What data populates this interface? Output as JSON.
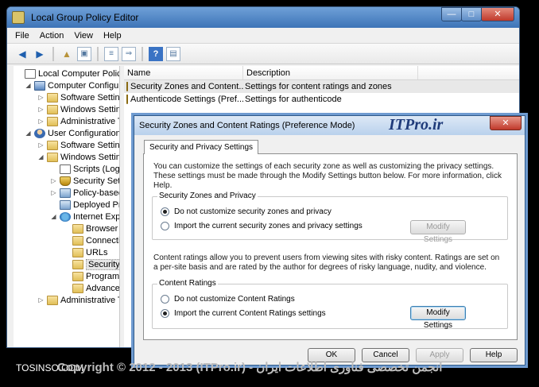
{
  "window": {
    "title": "Local Group Policy Editor",
    "buttons": [
      "—",
      "□",
      "✕"
    ]
  },
  "menu": [
    "File",
    "Action",
    "View",
    "Help"
  ],
  "toolbar": {
    "icons": [
      "back-icon",
      "forward-icon",
      "up-folder-icon",
      "show-hide-tree-icon",
      "export-list-icon",
      "properties-icon",
      "help-icon",
      "filter-icon"
    ],
    "help_glyph": "?"
  },
  "tree": [
    {
      "label": "Local Computer Policy",
      "icon": "policy"
    },
    {
      "label": "Computer Configura",
      "icon": "computer"
    },
    {
      "label": "Software Settings",
      "icon": "folder"
    },
    {
      "label": "Windows Setting",
      "icon": "folder"
    },
    {
      "label": "Administrative T",
      "icon": "folder"
    },
    {
      "label": "User Configuration",
      "icon": "user"
    },
    {
      "label": "Software Settings",
      "icon": "folder"
    },
    {
      "label": "Windows Setting",
      "icon": "folder"
    },
    {
      "label": "Scripts (Logo",
      "icon": "policy"
    },
    {
      "label": "Security Setti",
      "icon": "shield"
    },
    {
      "label": "Policy-based",
      "icon": "chart"
    },
    {
      "label": "Deployed Prin",
      "icon": "printer"
    },
    {
      "label": "Internet Explo",
      "icon": "ie"
    },
    {
      "label": "Browser U",
      "icon": "folder"
    },
    {
      "label": "Connectio",
      "icon": "folder"
    },
    {
      "label": "URLs",
      "icon": "folder"
    },
    {
      "label": "Security",
      "icon": "folder"
    },
    {
      "label": "Programs",
      "icon": "folder"
    },
    {
      "label": "Advanced",
      "icon": "folder"
    },
    {
      "label": "Administrative Te",
      "icon": "folder"
    }
  ],
  "list": {
    "headers": [
      "Name",
      "Description"
    ],
    "rows": [
      {
        "name": "Security Zones and Content...",
        "desc": "Settings for content ratings and zones"
      },
      {
        "name": "Authenticode Settings (Pref...",
        "desc": "Settings for authenticode"
      }
    ]
  },
  "dialog": {
    "title": "Security Zones and Content Ratings (Preference Mode)",
    "logo": "ITPro.ir",
    "close": "✕",
    "tab": "Security and Privacy Settings",
    "intro": "You can customize the settings of each security zone as well as customizing the privacy settings. These settings must be made through the Modify Settings button below. For more information, click Help.",
    "zones_group": "Security Zones and Privacy",
    "zones_opt1": "Do not customize security zones and privacy",
    "zones_opt2": "Import the current security zones and privacy settings",
    "modify_label": "Modify Settings",
    "ratings_text": "Content ratings allow you to prevent users from viewing sites with risky content. Ratings are set on a per-site basis and are rated by the author for degrees of risky language, nudity, and violence.",
    "ratings_group": "Content Ratings",
    "ratings_opt1": "Do not customize Content Ratings",
    "ratings_opt2": "Import the current Content Ratings settings",
    "ok": "OK",
    "cancel": "Cancel",
    "apply": "Apply",
    "help": "Help"
  },
  "footer": {
    "site": "TOSINSO.COM",
    "copyright": "Copyright © 2012 - 2013 (ITPro.ir) - انجمن تخصصی فناوری اطلاعات ایران"
  }
}
